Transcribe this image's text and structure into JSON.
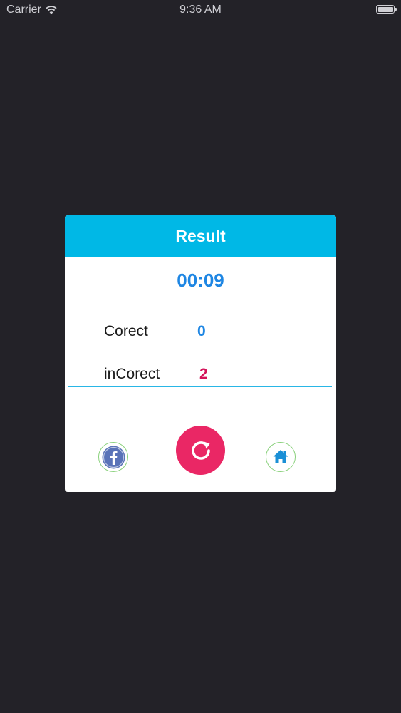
{
  "status_bar": {
    "carrier": "Carrier",
    "time": "9:36 AM",
    "wifi_icon": "wifi-icon",
    "battery_icon": "battery-icon",
    "battery_level": 1.0
  },
  "dialog": {
    "title": "Result",
    "timer": "00:09",
    "rows": [
      {
        "label": "Corect",
        "value": "0",
        "value_color": "#1e86e3"
      },
      {
        "label": "inCorect",
        "value": "2",
        "value_color": "#d4145a"
      }
    ],
    "buttons": {
      "share": "facebook-icon",
      "replay": "replay-icon",
      "home": "home-icon"
    }
  },
  "colors": {
    "background": "#232228",
    "header": "#00b8e6",
    "accent_blue": "#1e86e3",
    "accent_pink": "#ea2765",
    "divider": "#29b6e6",
    "facebook": "#3b5998"
  }
}
